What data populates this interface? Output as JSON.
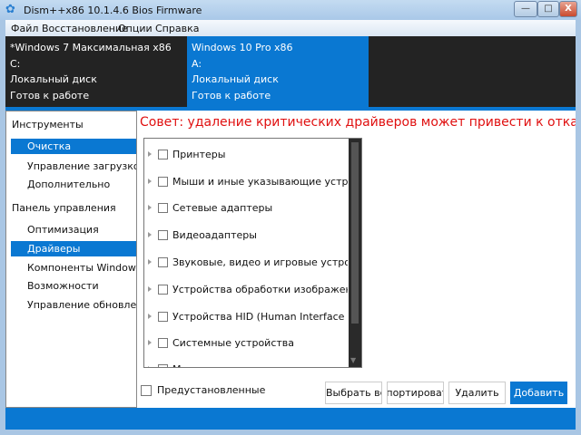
{
  "window": {
    "title": "Dism++x86 10.1.4.6 Bios Firmware",
    "minimize": "—",
    "maximize": "□",
    "close": "X"
  },
  "menu": [
    "Файл",
    "Восстановление",
    "Опции",
    "Справка"
  ],
  "systems": [
    {
      "name": "*Windows 7 Максимальная x86",
      "drive": "C:",
      "type": "Локальный диск",
      "status": "Готов к работе",
      "selected": false
    },
    {
      "name": "Windows 10 Pro x86",
      "drive": "A:",
      "type": "Локальный диск",
      "status": "Готов к работе",
      "selected": true
    }
  ],
  "sidebar": {
    "tools_header": "Инструменты",
    "tools": [
      "Очистка",
      "Управление загрузкой",
      "Дополнительно"
    ],
    "panel_header": "Панель управления",
    "panel": [
      "Оптимизация",
      "Драйверы",
      "Компоненты Windows",
      "Возможности",
      "Управление обновлениями"
    ]
  },
  "tip": "Совет: удаление критических драйверов может привести к отказу загрузки",
  "drivers": [
    "Принтеры",
    "Мыши и иные указывающие устройства",
    "Сетевые адаптеры",
    "Видеоадаптеры",
    "Звуковые, видео и игровые устройства",
    "Устройства обработки изображений",
    "Устройства HID (Human Interface Devices)",
    "Системные устройства",
    "М"
  ],
  "preinstalled_label": "Предустановленные",
  "buttons": {
    "select_all": "Выбрать все",
    "export": "Экспортировать драйверы",
    "delete": "Удалить",
    "add": "Добавить"
  },
  "colors": {
    "accent": "#0a78d2",
    "tip": "#e01010",
    "header_bg": "#232323"
  }
}
